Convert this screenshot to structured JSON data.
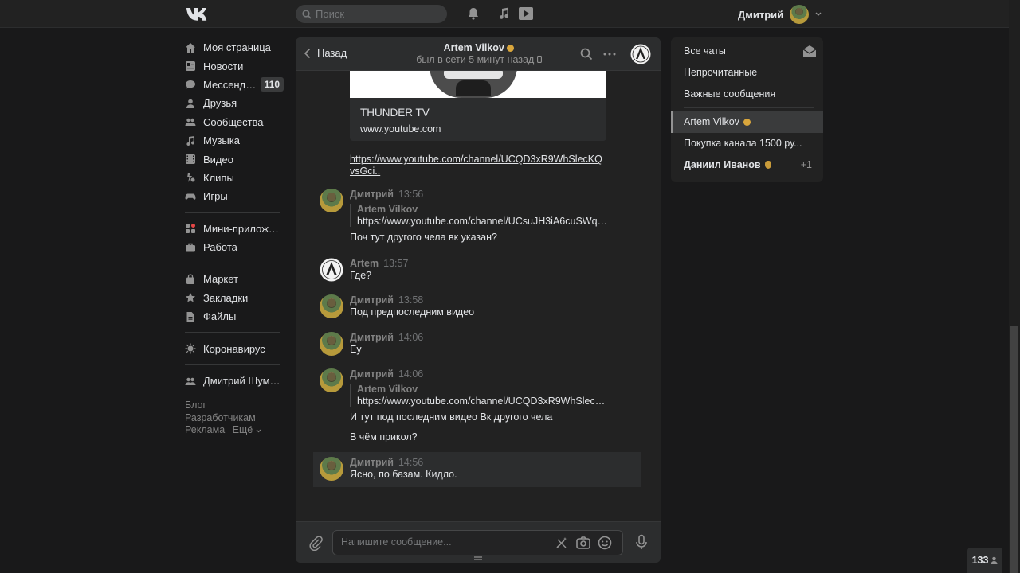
{
  "topbar": {
    "search_placeholder": "Поиск",
    "user_name": "Дмитрий"
  },
  "leftnav": {
    "items": [
      {
        "label": "Моя страница",
        "icon": "home-icon"
      },
      {
        "label": "Новости",
        "icon": "news-icon"
      },
      {
        "label": "Мессендж...",
        "icon": "messages-icon",
        "badge": "110"
      },
      {
        "label": "Друзья",
        "icon": "friend-icon"
      },
      {
        "label": "Сообщества",
        "icon": "groups-icon"
      },
      {
        "label": "Музыка",
        "icon": "music-icon"
      },
      {
        "label": "Видео",
        "icon": "video-icon"
      },
      {
        "label": "Клипы",
        "icon": "clips-icon"
      },
      {
        "label": "Игры",
        "icon": "gamepad-icon"
      }
    ],
    "items2": [
      {
        "label": "Мини-приложен...",
        "icon": "apps-icon"
      },
      {
        "label": "Работа",
        "icon": "briefcase-icon"
      }
    ],
    "items3": [
      {
        "label": "Маркет",
        "icon": "bag-icon"
      },
      {
        "label": "Закладки",
        "icon": "star-icon"
      },
      {
        "label": "Файлы",
        "icon": "file-icon"
      }
    ],
    "items4": [
      {
        "label": "Коронавирус",
        "icon": "virus-icon"
      }
    ],
    "items5": [
      {
        "label": "Дмитрий Шумил...",
        "icon": "users-icon"
      }
    ],
    "footer": {
      "blog": "Блог",
      "developers": "Разработчикам",
      "ads": "Реклама",
      "more": "Ещё"
    }
  },
  "chat": {
    "back_label": "Назад",
    "peer_name": "Artem Vilkov",
    "peer_status": "был в сети 5 минут назад",
    "embed": {
      "title": "THUNDER TV",
      "domain": "www.youtube.com"
    },
    "link_text": "https://www.youtube.com/channel/UCQD3xR9WhSlecKQvsGci..",
    "messages": [
      {
        "author": "Дмитрий",
        "time": "13:56",
        "fwd_author": "Artem Vilkov",
        "fwd_text": "https://www.youtube.com/channel/UCsuJH3iA6cuSWq8...",
        "text": "Поч тут другого чела вк указан?"
      },
      {
        "author": "Artem",
        "time": "13:57",
        "text": "Где?"
      },
      {
        "author": "Дмитрий",
        "time": "13:58",
        "text": "Под предпоследним видео"
      },
      {
        "author": "Дмитрий",
        "time": "14:06",
        "text": "Еу"
      },
      {
        "author": "Дмитрий",
        "time": "14:06",
        "fwd_author": "Artem Vilkov",
        "fwd_text": "https://www.youtube.com/channel/UCQD3xR9WhSlecKQ...",
        "text": "И тут под последним видео Вк другого чела",
        "text2": "В чём прикол?"
      },
      {
        "author": "Дмитрий",
        "time": "14:56",
        "text": "Ясно, по базам. Кидло."
      }
    ],
    "composer_placeholder": "Напишите сообщение..."
  },
  "rightpanel": {
    "filters": [
      "Все чаты",
      "Непрочитанные",
      "Важные сообщения"
    ],
    "chats": [
      {
        "name": "Artem Vilkov",
        "active": true
      },
      {
        "name": "Покупка канала 1500 ру..."
      },
      {
        "name": "Даниил Иванов",
        "count": "+1"
      }
    ]
  },
  "online_count": "133"
}
